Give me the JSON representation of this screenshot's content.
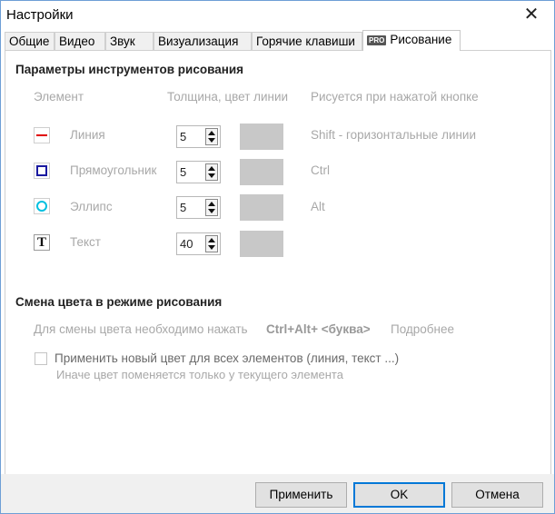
{
  "window": {
    "title": "Настройки",
    "close_glyph": "✕"
  },
  "tabs": [
    {
      "label": "Общие"
    },
    {
      "label": "Видео"
    },
    {
      "label": "Звук"
    },
    {
      "label": "Визуализация"
    },
    {
      "label": "Горячие клавиши"
    },
    {
      "label": "Рисование",
      "badge": "PRO",
      "active": true
    }
  ],
  "drawing_tools": {
    "title": "Параметры инструментов рисования",
    "col_element": "Элемент",
    "col_width_color": "Толщина, цвет линии",
    "col_key": "Рисуется при нажатой кнопке",
    "rows": [
      {
        "label": "Линия",
        "icon": "line-icon",
        "width": "5",
        "color": "#c8c8c8",
        "key": "Shift - горизонтальные линии"
      },
      {
        "label": "Прямоугольник",
        "icon": "rectangle-icon",
        "width": "5",
        "color": "#c8c8c8",
        "key": "Ctrl"
      },
      {
        "label": "Эллипс",
        "icon": "ellipse-icon",
        "width": "5",
        "color": "#c8c8c8",
        "key": "Alt"
      },
      {
        "label": "Текст",
        "icon": "text-icon",
        "width": "40",
        "color": "#c8c8c8",
        "key": ""
      }
    ]
  },
  "color_change": {
    "title": "Смена цвета в режиме рисования",
    "hint": "Для смены цвета необходимо нажать",
    "shortcut": "Ctrl+Alt+ <буква>",
    "more": "Подробнее",
    "apply_all_label": "Применить новый цвет для всех элементов (линия, текст ...)",
    "apply_all_checked": false,
    "apply_all_note": "Иначе цвет поменяется только у текущего элемента"
  },
  "footer": {
    "apply": "Применить",
    "ok": "OK",
    "cancel": "Отмена"
  },
  "colors": {
    "accent": "#0078d7",
    "line_icon": "#e00000",
    "rect_icon": "#1a1aa0",
    "ellipse_icon": "#00c0e0"
  }
}
